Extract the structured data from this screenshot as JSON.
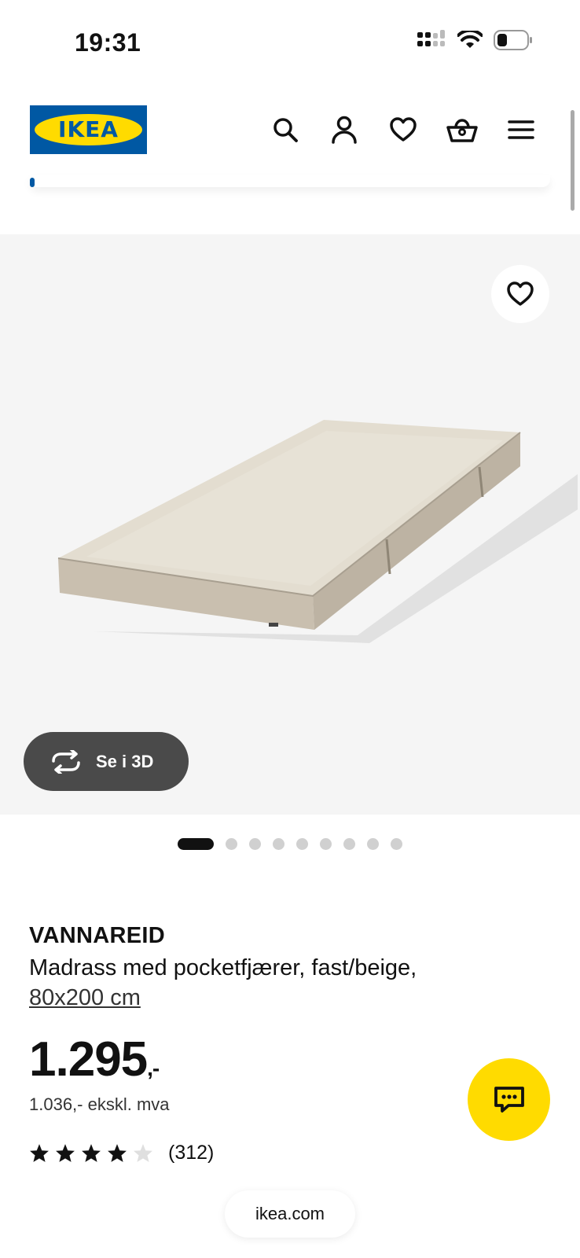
{
  "status_bar": {
    "time": "19:31",
    "icons": [
      "cellular-signal-icon",
      "wifi-icon",
      "battery-icon"
    ]
  },
  "header": {
    "logo_text": "IKEA",
    "icons": [
      "search-icon",
      "user-icon",
      "heart-icon",
      "basket-icon",
      "menu-icon"
    ]
  },
  "gallery": {
    "favorite_icon": "heart-icon",
    "view_3d_label": "Se i 3D",
    "image_count": 9,
    "active_index": 0
  },
  "product": {
    "name": "VANNAREID",
    "description": "Madrass med pocketfjærer, fast/beige,",
    "size": "80x200 cm",
    "price": "1.295",
    "price_suffix": ",-",
    "price_excl_vat": "1.036,- ekskl. mva",
    "rating": 4,
    "rating_max": 5,
    "review_count": "(312)"
  },
  "chat": {
    "icon": "chat-icon"
  },
  "browser": {
    "url": "ikea.com"
  },
  "colors": {
    "ikea_blue": "#0058a3",
    "ikea_yellow": "#ffdb00",
    "dark_button": "#4a4a4a"
  }
}
